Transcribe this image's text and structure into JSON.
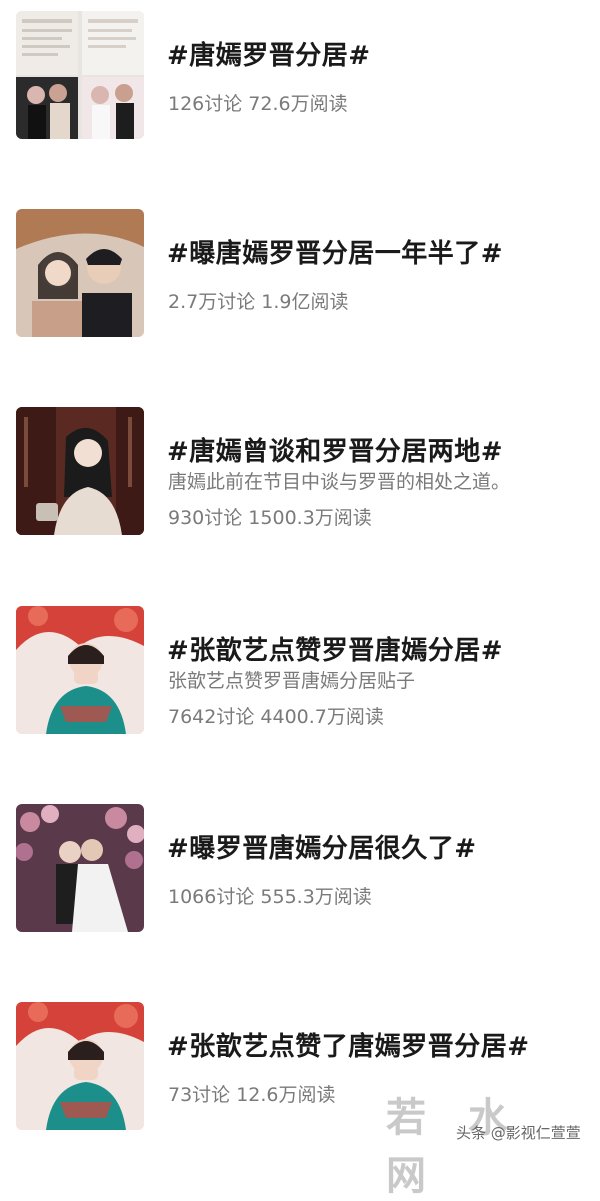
{
  "topics": [
    {
      "title": "#唐嫣罗晋分居#",
      "description": "",
      "stats": "126讨论 72.6万阅读",
      "thumbnail_colors": [
        "#e8e4df",
        "#2b2b2b",
        "#d9b7b0"
      ]
    },
    {
      "title": "#曝唐嫣罗晋分居一年半了#",
      "description": "",
      "stats": "2.7万讨论 1.9亿阅读",
      "thumbnail_colors": [
        "#b07a55",
        "#1e1e22",
        "#c8a08a"
      ]
    },
    {
      "title": "#唐嫣曾谈和罗晋分居两地#",
      "description": "唐嫣此前在节目中谈与罗晋的相处之道。",
      "stats": "930讨论 1500.3万阅读",
      "thumbnail_colors": [
        "#5a2a22",
        "#e6dcd2",
        "#1b1b1b"
      ]
    },
    {
      "title": "#张歆艺点赞罗晋唐嫣分居#",
      "description": "张歆艺点赞罗晋唐嫣分居贴子",
      "stats": "7642讨论 4400.7万阅读",
      "thumbnail_colors": [
        "#e7a08a",
        "#1d8f8a",
        "#d4423a"
      ]
    },
    {
      "title": "#曝罗晋唐嫣分居很久了#",
      "description": "",
      "stats": "1066讨论 555.3万阅读",
      "thumbnail_colors": [
        "#5a3a4a",
        "#f2f2f2",
        "#1e1e1e"
      ]
    },
    {
      "title": "#张歆艺点赞了唐嫣罗晋分居#",
      "description": "",
      "stats": "73讨论 12.6万阅读",
      "thumbnail_colors": [
        "#e7a08a",
        "#1d8f8a",
        "#d4423a"
      ]
    }
  ],
  "watermark": {
    "site": "若 水 网",
    "credit": "头条 @影视仁萱萱"
  }
}
